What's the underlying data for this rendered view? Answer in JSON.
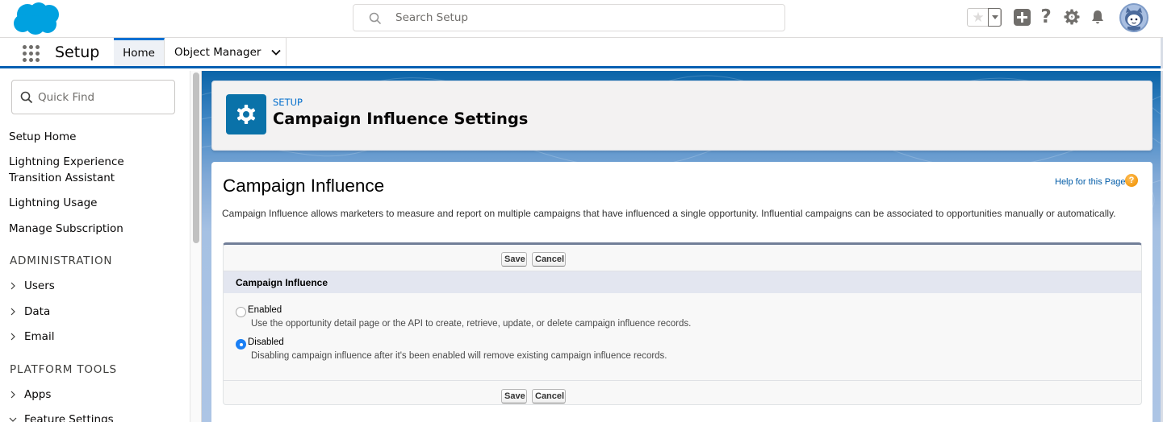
{
  "global_header": {
    "logo": "salesforce-cloud-logo",
    "search": {
      "placeholder": "Search Setup",
      "value": "",
      "icon": "search-icon"
    },
    "actions": [
      {
        "name": "favorites-star",
        "icon": "star-icon"
      },
      {
        "name": "favorites-dropdown",
        "icon": "caret-down-icon"
      },
      {
        "name": "global-actions",
        "icon": "plus-icon"
      },
      {
        "name": "help",
        "icon": "question-icon",
        "glyph": "?"
      },
      {
        "name": "setup",
        "icon": "gear-icon"
      },
      {
        "name": "notifications",
        "icon": "bell-icon"
      },
      {
        "name": "user-avatar",
        "icon": "avatar-icon"
      }
    ]
  },
  "context_bar": {
    "app_launcher_icon": "app-launcher-grid-icon",
    "app_name": "Setup",
    "tabs": [
      {
        "label": "Home",
        "active": true
      },
      {
        "label": "Object Manager",
        "active": false,
        "has_dropdown": true
      }
    ]
  },
  "sidebar": {
    "quick_find": {
      "placeholder": "Quick Find",
      "value": ""
    },
    "links": [
      {
        "label": "Setup Home"
      },
      {
        "label": "Lightning Experience Transition Assistant"
      },
      {
        "label": "Lightning Usage"
      },
      {
        "label": "Manage Subscription"
      }
    ],
    "sections": [
      {
        "heading": "ADMINISTRATION",
        "items": [
          {
            "label": "Users",
            "expanded": false
          },
          {
            "label": "Data",
            "expanded": false
          },
          {
            "label": "Email",
            "expanded": false
          }
        ]
      },
      {
        "heading": "PLATFORM TOOLS",
        "items": [
          {
            "label": "Apps",
            "expanded": false
          },
          {
            "label": "Feature Settings",
            "expanded": true
          }
        ]
      }
    ]
  },
  "page_header": {
    "icon": "gear-icon",
    "eyebrow": "SETUP",
    "title": "Campaign Influence Settings"
  },
  "content": {
    "title": "Campaign Influence",
    "help_link": "Help for this Page",
    "help_badge": "?",
    "description": "Campaign Influence allows marketers to measure and report on multiple campaigns that have influenced a single opportunity. Influential campaigns can be associated to opportunities manually or automatically.",
    "buttons": {
      "save": "Save",
      "cancel": "Cancel"
    },
    "section_title": "Campaign Influence",
    "options": [
      {
        "label": "Enabled",
        "help": "Use the opportunity detail page or the API to create, retrieve, update, or delete campaign influence records.",
        "selected": false
      },
      {
        "label": "Disabled",
        "help": "Disabling campaign influence after it's been enabled will remove existing campaign influence records.",
        "selected": true
      }
    ]
  },
  "colors": {
    "brand_blue": "#00a1e0",
    "context_bar_accent": "#005fb2",
    "tab_active_accent": "#0070d2",
    "page_icon_bg": "#0a72a9",
    "link_blue": "#015ba7",
    "radio_selected": "#1a7ff5",
    "section_header_bg": "#e3e6f0",
    "help_badge": "#f39a12"
  }
}
